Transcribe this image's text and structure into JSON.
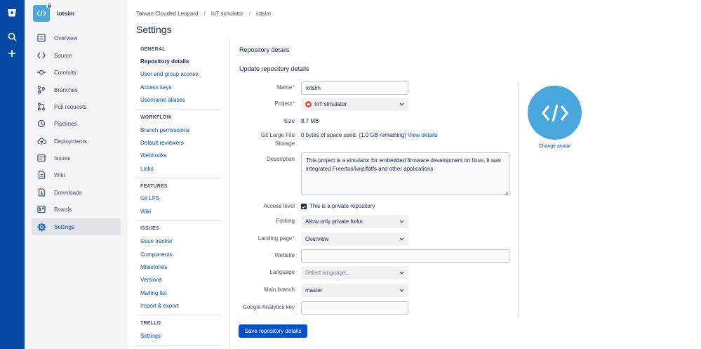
{
  "global_nav": {
    "items": [
      {
        "icon": "bitbucket-logo-icon"
      },
      {
        "icon": "search-icon"
      },
      {
        "icon": "plus-icon"
      }
    ]
  },
  "repo": {
    "name": "iotsim",
    "nav": [
      {
        "label": "Overview",
        "icon": "overview-icon"
      },
      {
        "label": "Source",
        "icon": "source-code-icon"
      },
      {
        "label": "Commits",
        "icon": "commits-icon"
      },
      {
        "label": "Branches",
        "icon": "branches-icon"
      },
      {
        "label": "Pull requests",
        "icon": "pull-requests-icon"
      },
      {
        "label": "Pipelines",
        "icon": "pipelines-icon"
      },
      {
        "label": "Deployments",
        "icon": "deployments-icon"
      },
      {
        "label": "Issues",
        "icon": "issues-icon"
      },
      {
        "label": "Wiki",
        "icon": "wiki-icon"
      },
      {
        "label": "Downloads",
        "icon": "downloads-icon"
      },
      {
        "label": "Boards",
        "icon": "boards-icon"
      },
      {
        "label": "Settings",
        "icon": "settings-gear-icon",
        "active": true
      }
    ]
  },
  "breadcrumb": [
    "Taiwan Clouded Leopard",
    "IoT simulator",
    "iotsim"
  ],
  "page_title": "Settings",
  "settings_nav": {
    "groups": [
      {
        "title": "GENERAL",
        "links": [
          "Repository details",
          "User and group access",
          "Access keys",
          "Username aliases"
        ],
        "current": "Repository details"
      },
      {
        "title": "WORKFLOW",
        "links": [
          "Branch permissions",
          "Default reviewers",
          "Webhooks",
          "Links"
        ]
      },
      {
        "title": "FEATURES",
        "links": [
          "Git LFS",
          "Wiki"
        ]
      },
      {
        "title": "ISSUES",
        "links": [
          "Issue tracker",
          "Components",
          "Milestones",
          "Versions",
          "Mailing list",
          "Import & export"
        ]
      },
      {
        "title": "TRELLO",
        "links": [
          "Settings"
        ]
      }
    ]
  },
  "form": {
    "section_title": "Repository details",
    "subsection_title": "Update repository details",
    "name": {
      "label": "Name",
      "value": "iotsim"
    },
    "project": {
      "label": "Project",
      "value": "IoT simulator"
    },
    "size": {
      "label": "Size",
      "value": "8.7 MB"
    },
    "lfs": {
      "label": "Git Large File Storage",
      "value": "0 bytes of space used. (1.0 GB remaining)",
      "link": "View details"
    },
    "description": {
      "label": "Description",
      "value": "This project is a simulator for embedded firmware development on linux, it was integrated Freertos/lwip/fatfs and other applications"
    },
    "access_level": {
      "label": "Access level",
      "checkbox_label": "This is a private repository",
      "checked": true
    },
    "forking": {
      "label": "Forking",
      "value": "Allow only private forks"
    },
    "landing_page": {
      "label": "Landing page",
      "value": "Overview"
    },
    "website": {
      "label": "Website",
      "value": ""
    },
    "language": {
      "label": "Language",
      "placeholder": "Select language..."
    },
    "main_branch": {
      "label": "Main branch",
      "value": "master"
    },
    "analytics": {
      "label": "Google Analytics key",
      "value": ""
    },
    "required_marker": "*",
    "save_label": "Save repository details"
  },
  "avatar": {
    "change_label": "Change avatar"
  },
  "colors": {
    "global_nav": "#0747a6",
    "accent": "#0052cc",
    "avatar": "#4aa7dd",
    "required": "#de350b"
  }
}
